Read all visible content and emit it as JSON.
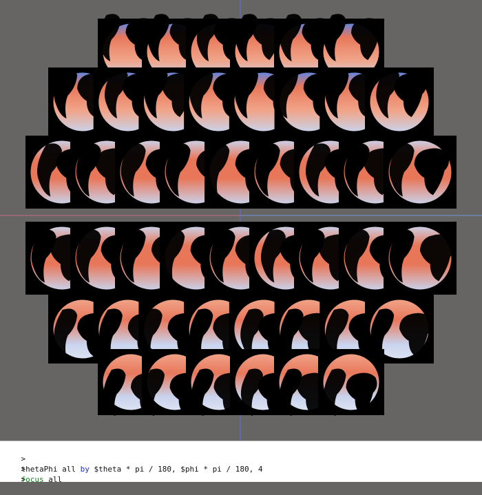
{
  "app": {
    "console_lines": [
      {
        "prompt": ">",
        "parts": [
          {
            "text": "thetaPhi all ",
            "style": "plain"
          },
          {
            "text": "by",
            "style": "kw-by"
          },
          {
            "text": " $theta * pi / 180, $phi * pi / 180, 4",
            "style": "plain"
          }
        ]
      },
      {
        "prompt": ">",
        "parts": [
          {
            "text": "focus",
            "style": "kw-focus"
          },
          {
            "text": " all",
            "style": "plain"
          }
        ]
      },
      {
        "prompt": ">",
        "parts": []
      }
    ]
  },
  "colors": {
    "background": "#676563",
    "axis_vertical": "#5b6fb8",
    "axis_horizontal_left": "#a8687e",
    "axis_horizontal_right": "#6f86b8",
    "ocean_warm": "#e8775a",
    "ocean_mid": "#f0a58a",
    "ocean_cool": "#c9d3ec",
    "ocean_cold": "#5c86e6",
    "land": "#000000",
    "console_bg": "#ffffff"
  },
  "scene": {
    "object_kind": "globe-thumbnail",
    "rows": [
      {
        "count": 6
      },
      {
        "count": 8
      },
      {
        "count": 9
      },
      {
        "count": 9
      },
      {
        "count": 8
      },
      {
        "count": 6
      }
    ]
  }
}
